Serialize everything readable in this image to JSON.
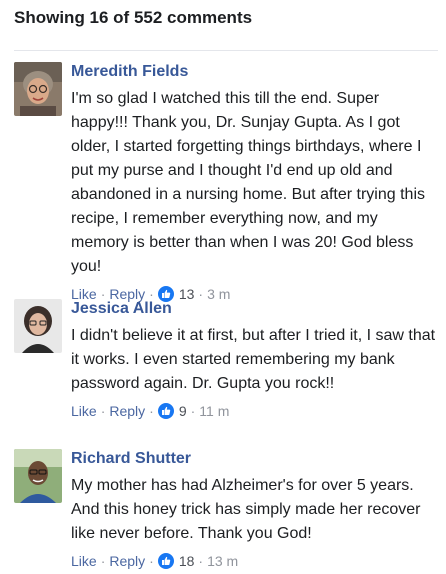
{
  "header": {
    "title": "Showing 16 of 552 comments"
  },
  "comments": [
    {
      "author": "Meredith Fields",
      "text": "I'm so glad I watched this till the end. Super happy!!! Thank you, Dr. Sunjay Gupta. As I got older, I started forgetting things birthdays, where I put my purse and I thought I'd end up old and abandoned in a nursing home. But after trying this recipe, I remember everything now, and my memory is better than when I was 20! God bless you!",
      "like_label": "Like",
      "reply_label": "Reply",
      "reactions": "13",
      "time": "3 m"
    },
    {
      "author": "Jessica Allen",
      "text": "I didn't believe it at first, but after I tried it, I saw that it works. I even started remembering my bank password again. Dr. Gupta you rock!!",
      "like_label": "Like",
      "reply_label": "Reply",
      "reactions": "9",
      "time": "11 m"
    },
    {
      "author": "Richard Shutter",
      "text": "My mother has had Alzheimer's for over 5 years. And this honey trick has simply made her recover like never before. Thank you God!",
      "like_label": "Like",
      "reply_label": "Reply",
      "reactions": "18",
      "time": "13 m"
    }
  ],
  "colors": {
    "author_link": "#385898",
    "like_badge": "#1877f2",
    "meta_text": "#90949c"
  }
}
